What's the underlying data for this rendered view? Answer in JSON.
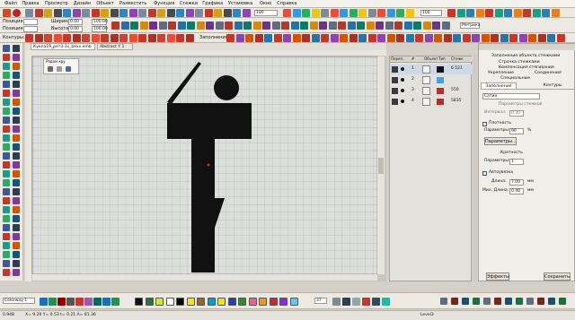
{
  "menu": [
    "Файл",
    "Правка",
    "Просмотр",
    "Дизайн",
    "Объект",
    "Разместить",
    "Функция",
    "Стежки",
    "Графика",
    "Установка",
    "Окно",
    "Справка"
  ],
  "zoom_value": "100",
  "zoom_value2": "100",
  "props": {
    "pos_x_label": "Позиция X:",
    "pos_x": "",
    "pos_y_label": "Позиция Y:",
    "pos_y": "",
    "width_label": "Ширина:",
    "width": "0.00",
    "height_label": "Высота:",
    "height": "0.00",
    "w2": "100.00",
    "h2": "100.00"
  },
  "metric_label": "Метрика",
  "toolbar_labels": {
    "contours": "Контуры:",
    "fill": "Заполнение:"
  },
  "tabs": [
    "Кукла19_рет3-1s_bxxx.emb",
    "Abstract Y 1"
  ],
  "overview_label": "Рядом кру",
  "seq_headers": [
    "Переп..",
    "#",
    "Объект",
    "Тип",
    "Стежк"
  ],
  "seq_rows": [
    {
      "num": "1",
      "count": "6 521"
    },
    {
      "num": "2",
      "count": ""
    },
    {
      "num": "3",
      "count": "550"
    },
    {
      "num": "4",
      "count": "5835"
    }
  ],
  "props_panel": {
    "title": "Заполнение объекта стежками",
    "menu_items": [
      "Строчка стежками",
      "Компенсация стягивания",
      "Укрепление",
      "Соединения",
      "Специальные"
    ],
    "tab_fill": "Заполнение",
    "tab_contours": "Контуры",
    "type_value": "Сатин",
    "stitch_params": "Параметры стежков",
    "spacing_label": "Интервал:",
    "spacing_value": "0.30",
    "density_chk": "Плотность",
    "params_label": "Параметры:",
    "params_value": "90",
    "percent": "%",
    "params_btn": "Параметры...",
    "ratio_label": "Кратность",
    "ratio_params": "Параметры:",
    "ratio_value": "1",
    "autosplit": "Автоувязка",
    "length_label": "Длина:",
    "length_value": "7.00",
    "mm": "мм",
    "minlen_label": "Мин. Длина:",
    "minlen_value": "0.40",
    "effects_btn": "Эффекты",
    "save_btn": "Сохранить"
  },
  "bottom_select": "Colorway 1",
  "page_value": "37",
  "status": {
    "left": "0.948",
    "coords": "X= 9.20 Y= 0.53 t= 0.21 A= 81.36",
    "right": "Level3"
  },
  "palette": [
    "#111111",
    "#1e7a3a",
    "#c8f02a",
    "#ffffff",
    "#000000",
    "#ffe400",
    "#8c6b2a",
    "#00a0c8",
    "#e8e800",
    "#1f3fbf",
    "#2a8f2a",
    "#f06090",
    "#ff9900",
    "#e02020",
    "#8a2be2",
    "#60c8f0"
  ]
}
